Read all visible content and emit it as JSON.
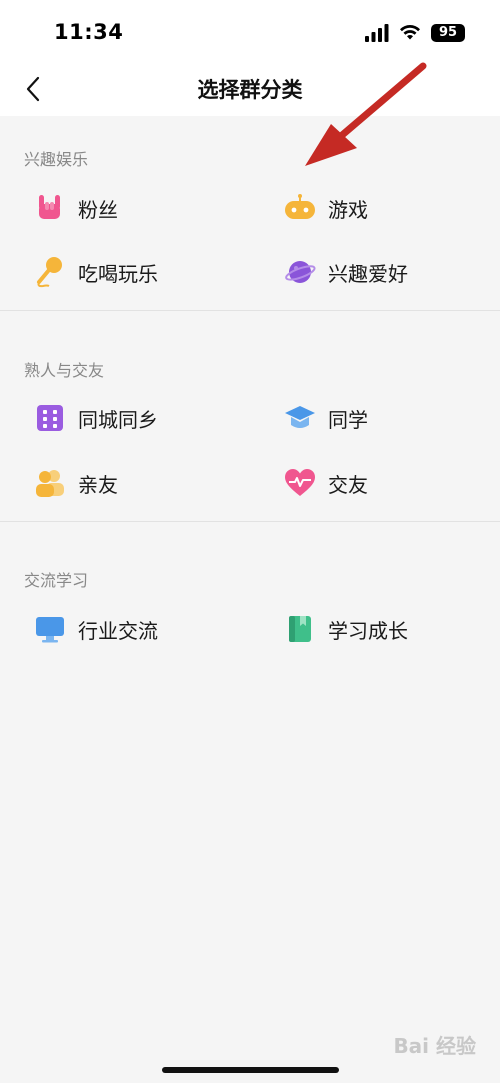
{
  "status_bar": {
    "time": "11:34",
    "battery": "95"
  },
  "nav": {
    "title": "选择群分类"
  },
  "sections": [
    {
      "header": "兴趣娱乐",
      "items": [
        {
          "label": "粉丝",
          "icon": "rock-hand-icon",
          "color": "#f0568f"
        },
        {
          "label": "游戏",
          "icon": "game-robot-icon",
          "color": "#f5b53a"
        },
        {
          "label": "吃喝玩乐",
          "icon": "microphone-icon",
          "color": "#f5b53a"
        },
        {
          "label": "兴趣爱好",
          "icon": "planet-icon",
          "color": "#8a55d9"
        }
      ]
    },
    {
      "header": "熟人与交友",
      "items": [
        {
          "label": "同城同乡",
          "icon": "building-icon",
          "color": "#9a5ce0"
        },
        {
          "label": "同学",
          "icon": "graduation-cap-icon",
          "color": "#4a97e8"
        },
        {
          "label": "亲友",
          "icon": "people-icon",
          "color": "#f5b53a"
        },
        {
          "label": "交友",
          "icon": "heart-pulse-icon",
          "color": "#f0568f"
        }
      ]
    },
    {
      "header": "交流学习",
      "items": [
        {
          "label": "行业交流",
          "icon": "monitor-icon",
          "color": "#4a97e8"
        },
        {
          "label": "学习成长",
          "icon": "book-icon",
          "color": "#3fbf8a"
        }
      ]
    }
  ],
  "watermark": "Bai 经验",
  "colors": {
    "annotation_arrow": "#c52a24",
    "background": "#f5f5f5"
  }
}
